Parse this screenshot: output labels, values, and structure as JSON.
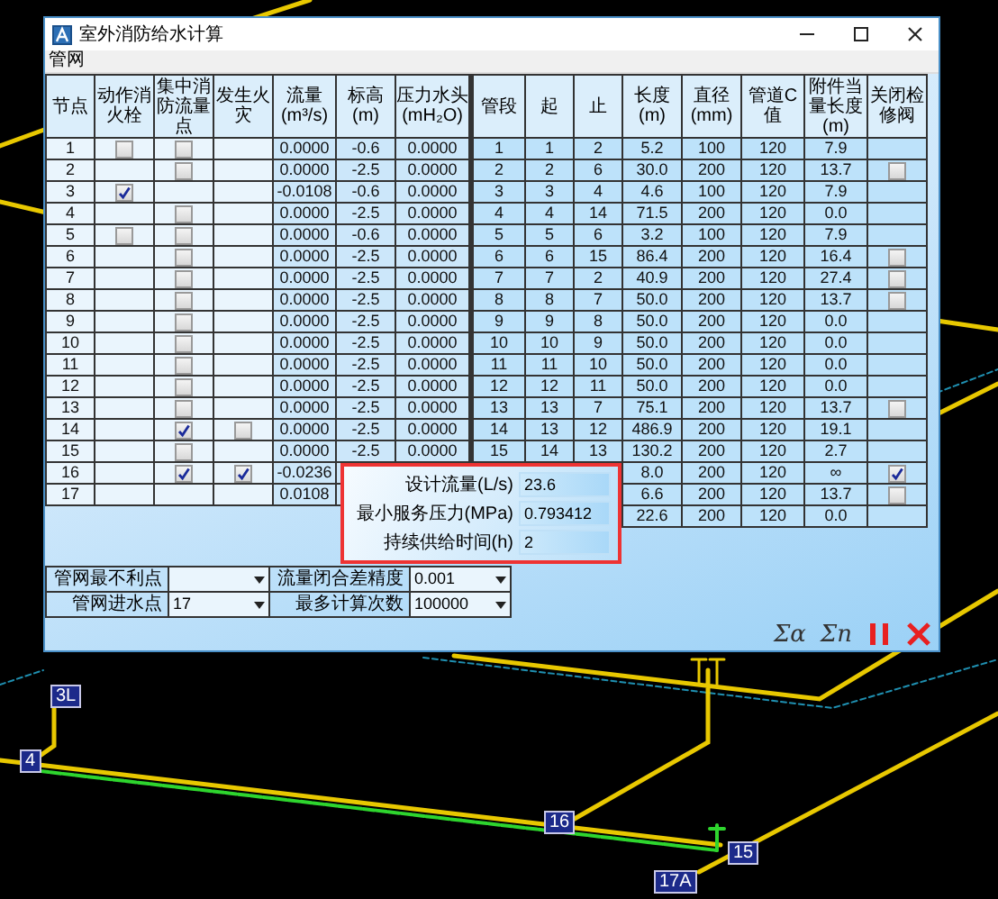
{
  "window": {
    "title": "室外消防给水计算"
  },
  "menu": [
    "管网"
  ],
  "left_table": {
    "columns": [
      "节点",
      "动作消火栓",
      "集中消防流量点",
      "发生火灾",
      "流量 (m³/s)",
      "标高 (m)",
      "压力水头 (mH₂O)"
    ],
    "rows": [
      {
        "node": "1",
        "hydrant": false,
        "concentrated": false,
        "flow": "0.0000",
        "elevation": "-0.6",
        "head": "0.0000"
      },
      {
        "node": "2",
        "concentrated": false,
        "flow": "0.0000",
        "elevation": "-2.5",
        "head": "0.0000"
      },
      {
        "node": "3",
        "hydrant": true,
        "flow": "-0.0108",
        "elevation": "-0.6",
        "head": "0.0000"
      },
      {
        "node": "4",
        "concentrated": false,
        "flow": "0.0000",
        "elevation": "-2.5",
        "head": "0.0000"
      },
      {
        "node": "5",
        "hydrant": false,
        "concentrated": false,
        "flow": "0.0000",
        "elevation": "-0.6",
        "head": "0.0000"
      },
      {
        "node": "6",
        "concentrated": false,
        "flow": "0.0000",
        "elevation": "-2.5",
        "head": "0.0000"
      },
      {
        "node": "7",
        "concentrated": false,
        "flow": "0.0000",
        "elevation": "-2.5",
        "head": "0.0000"
      },
      {
        "node": "8",
        "concentrated": false,
        "flow": "0.0000",
        "elevation": "-2.5",
        "head": "0.0000"
      },
      {
        "node": "9",
        "concentrated": false,
        "flow": "0.0000",
        "elevation": "-2.5",
        "head": "0.0000"
      },
      {
        "node": "10",
        "concentrated": false,
        "flow": "0.0000",
        "elevation": "-2.5",
        "head": "0.0000"
      },
      {
        "node": "11",
        "concentrated": false,
        "flow": "0.0000",
        "elevation": "-2.5",
        "head": "0.0000"
      },
      {
        "node": "12",
        "concentrated": false,
        "flow": "0.0000",
        "elevation": "-2.5",
        "head": "0.0000"
      },
      {
        "node": "13",
        "concentrated": false,
        "flow": "0.0000",
        "elevation": "-2.5",
        "head": "0.0000"
      },
      {
        "node": "14",
        "concentrated": true,
        "fire": false,
        "flow": "0.0000",
        "elevation": "-2.5",
        "head": "0.0000"
      },
      {
        "node": "15",
        "concentrated": false,
        "flow": "0.0000",
        "elevation": "-2.5",
        "head": "0.0000"
      },
      {
        "node": "16",
        "concentrated": true,
        "fire": true,
        "flow": "-0.0236"
      },
      {
        "node": "17",
        "flow": "0.0108"
      }
    ]
  },
  "right_table": {
    "columns": [
      "管段",
      "起",
      "止",
      "长度 (m)",
      "直径 (mm)",
      "管道C值",
      "附件当量长度(m)",
      "关闭检修阀"
    ],
    "rows": [
      {
        "segment": "1",
        "from": "1",
        "to": "2",
        "length": "5.2",
        "diameter": "100",
        "c_value": "120",
        "fitting_length": "7.9"
      },
      {
        "segment": "2",
        "from": "2",
        "to": "6",
        "length": "30.0",
        "diameter": "200",
        "c_value": "120",
        "fitting_length": "13.7",
        "valve": false
      },
      {
        "segment": "3",
        "from": "3",
        "to": "4",
        "length": "4.6",
        "diameter": "100",
        "c_value": "120",
        "fitting_length": "7.9"
      },
      {
        "segment": "4",
        "from": "4",
        "to": "14",
        "length": "71.5",
        "diameter": "200",
        "c_value": "120",
        "fitting_length": "0.0"
      },
      {
        "segment": "5",
        "from": "5",
        "to": "6",
        "length": "3.2",
        "diameter": "100",
        "c_value": "120",
        "fitting_length": "7.9"
      },
      {
        "segment": "6",
        "from": "6",
        "to": "15",
        "length": "86.4",
        "diameter": "200",
        "c_value": "120",
        "fitting_length": "16.4",
        "valve": false
      },
      {
        "segment": "7",
        "from": "7",
        "to": "2",
        "length": "40.9",
        "diameter": "200",
        "c_value": "120",
        "fitting_length": "27.4",
        "valve": false
      },
      {
        "segment": "8",
        "from": "8",
        "to": "7",
        "length": "50.0",
        "diameter": "200",
        "c_value": "120",
        "fitting_length": "13.7",
        "valve": false
      },
      {
        "segment": "9",
        "from": "9",
        "to": "8",
        "length": "50.0",
        "diameter": "200",
        "c_value": "120",
        "fitting_length": "0.0"
      },
      {
        "segment": "10",
        "from": "10",
        "to": "9",
        "length": "50.0",
        "diameter": "200",
        "c_value": "120",
        "fitting_length": "0.0"
      },
      {
        "segment": "11",
        "from": "11",
        "to": "10",
        "length": "50.0",
        "diameter": "200",
        "c_value": "120",
        "fitting_length": "0.0"
      },
      {
        "segment": "12",
        "from": "12",
        "to": "11",
        "length": "50.0",
        "diameter": "200",
        "c_value": "120",
        "fitting_length": "0.0"
      },
      {
        "segment": "13",
        "from": "13",
        "to": "7",
        "length": "75.1",
        "diameter": "200",
        "c_value": "120",
        "fitting_length": "13.7",
        "valve": false
      },
      {
        "segment": "14",
        "from": "13",
        "to": "12",
        "length": "486.9",
        "diameter": "200",
        "c_value": "120",
        "fitting_length": "19.1"
      },
      {
        "segment": "15",
        "from": "14",
        "to": "13",
        "length": "130.2",
        "diameter": "200",
        "c_value": "120",
        "fitting_length": "2.7"
      },
      {
        "length": "8.0",
        "diameter": "200",
        "c_value": "120",
        "fitting_length": "∞",
        "valve": true
      },
      {
        "length": "6.6",
        "diameter": "200",
        "c_value": "120",
        "fitting_length": "13.7",
        "valve": false
      },
      {
        "length": "22.6",
        "diameter": "200",
        "c_value": "120",
        "fitting_length": "0.0"
      }
    ]
  },
  "summary": [
    {
      "label": "设计流量(L/s)",
      "value": "23.6"
    },
    {
      "label": "最小服务压力(MPa)",
      "value": "0.793412"
    },
    {
      "label": "持续供给时间(h)",
      "value": "2"
    }
  ],
  "params": [
    {
      "label": "管网最不利点"
    },
    {
      "label": "流量闭合差精度",
      "value": "0.001"
    },
    {
      "label": "管网进水点",
      "value": "17"
    },
    {
      "label": "最多计算次数",
      "value": "100000"
    }
  ],
  "tools": [
    {
      "kind": "text",
      "label": "Σα"
    },
    {
      "kind": "text",
      "label": "Σn"
    },
    {
      "kind": "pause"
    },
    {
      "kind": "close"
    }
  ],
  "canvas_labels": [
    {
      "text": "3L"
    },
    {
      "text": "4"
    },
    {
      "text": "16"
    },
    {
      "text": "15"
    },
    {
      "text": "17A"
    }
  ]
}
